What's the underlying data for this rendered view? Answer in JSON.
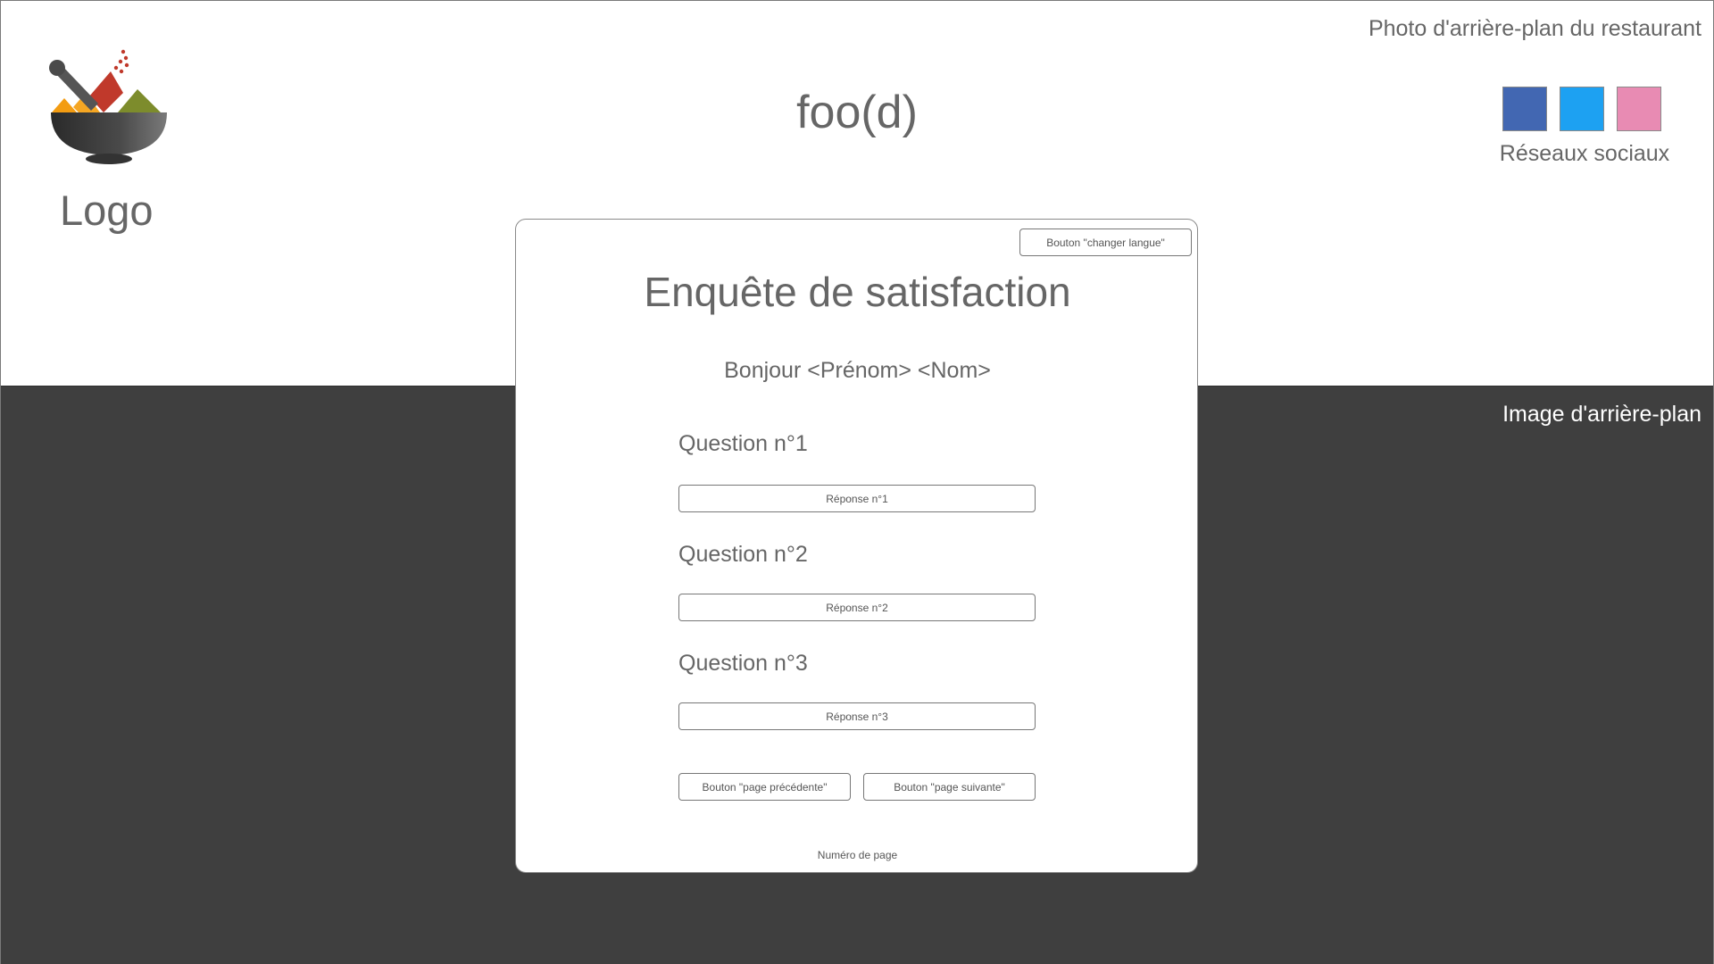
{
  "header": {
    "photo_label": "Photo d'arrière-plan du restaurant",
    "logo_label": "Logo",
    "brand": "foo(d)",
    "social": {
      "label": "Réseaux sociaux",
      "colors": [
        "#4267b2",
        "#1da1f2",
        "#e88bb3"
      ]
    }
  },
  "background": {
    "label": "Image d'arrière-plan",
    "color": "#3f3f3f"
  },
  "survey": {
    "lang_button": "Bouton \"changer langue\"",
    "title": "Enquête de satisfaction",
    "greeting": "Bonjour <Prénom> <Nom>",
    "questions": [
      {
        "label": "Question n°1",
        "answer": "Réponse n°1"
      },
      {
        "label": "Question n°2",
        "answer": "Réponse n°2"
      },
      {
        "label": "Question n°3",
        "answer": "Réponse n°3"
      }
    ],
    "prev_button": "Bouton \"page précédente\"",
    "next_button": "Bouton \"page suivante\"",
    "page_number": "Numéro de page"
  }
}
